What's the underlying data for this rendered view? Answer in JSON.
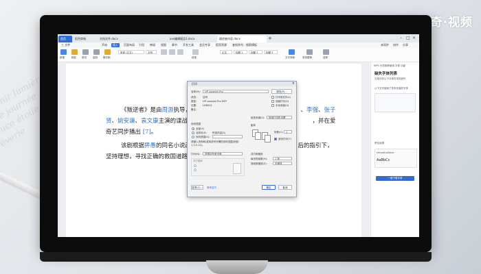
{
  "watermark": "天奇·视频",
  "tabs": [
    {
      "label": "首页"
    },
    {
      "label": "稻壳商城"
    },
    {
      "label": "文档文件.docx"
    },
    {
      "label": "xxx编辑报告1.docx"
    },
    {
      "label": "叛逆者内容.docx"
    }
  ],
  "menu": {
    "file": "三 文件",
    "items": [
      "开始",
      "插入",
      "页面布局",
      "引用",
      "审阅",
      "视图",
      "章节",
      "开发工具",
      "会员专享",
      "稻壳资源"
    ],
    "active": "开始",
    "search": "查找命令、搜索模板",
    "right": [
      "未同步",
      "协作",
      "分享"
    ]
  },
  "ribbon": {
    "font_name": "宋体 (正文)",
    "font_size": "五号",
    "style_normal": "正文",
    "labels": [
      "新建",
      "粘贴",
      "剪切",
      "复制",
      "格式刷",
      "段落",
      "文字排版",
      "查找替换",
      "选择"
    ],
    "styles": [
      "标题 1",
      "标题 2",
      "标题 3"
    ]
  },
  "document": {
    "p1": {
      "a": "《叛逆者》是由",
      "b": "周游",
      "c": "执导，",
      "d": "、",
      "e": "李强",
      "f": "、",
      "g": "张子",
      "h": "贤",
      "i": "、",
      "j": "姚安濂",
      "k": "、",
      "l": "袁文康",
      "m": "主演的谍战",
      "n": "，并在爱",
      "o": "奇艺同步播出",
      "p": "[7]",
      "q": "。"
    },
    "p2": {
      "a": "该剧根据",
      "b": "畀愚",
      "c": "的同名小说改",
      "d": "后的指引下，",
      "e": "坚持理想，寻找正确的救国道路"
    }
  },
  "dialog": {
    "title": "打印",
    "printer_label": "名称(M):",
    "printer": "HP LaserJet Pro",
    "properties": "属性(P)...",
    "status_label": "状态:",
    "status": "空闲",
    "type_label": "类型:",
    "type": "HP LaserJet Pro MFP",
    "location_label": "位置:",
    "location": "USB001",
    "comment_label": "备注:",
    "to_file": "打印到文件(L)",
    "duplex": "双面打印(X)",
    "manual": "手动双面(U)",
    "mode_label": "纸张来源(S):",
    "mode": "使用打印机设置",
    "range_title": "页码范围",
    "all": "全部(A)",
    "current": "当前页(E)",
    "selected": "所选内容(S)",
    "pages": "页码范围(G):",
    "hint": "请键入页码和/或用逗号分隔的页码范围(例如: 1,3,5-12)。",
    "print_label": "打印(N):",
    "print_value": "范围中所有页面",
    "copies_title": "副本",
    "copies_label": "份数(C):",
    "copies": "1",
    "collate": "逐份打印(T)",
    "zoom_title": "并打和缩放",
    "pages_per_sheet_label": "每页的版数(H):",
    "pages_per_sheet": "1 版",
    "scale_label": "按纸型缩放(Z):",
    "scale": "无缩放",
    "order_title": "并打顺序",
    "options": "选项(O)...",
    "tips": "操作技巧",
    "ok": "确定",
    "cancel": "取消"
  },
  "right_panel": {
    "top": "WPS 为您推荐使用 字体 功能",
    "title": "缺失字体列表",
    "sub": "文档中的以下字体在本机缺失",
    "item1": "以下文字使用了您未安装的字体",
    "item2": "字体名称",
    "preview_title": "预览效果",
    "font_name": "HelveticaNeue",
    "sample": "AaBbCc",
    "button": "一键下载字体"
  }
}
